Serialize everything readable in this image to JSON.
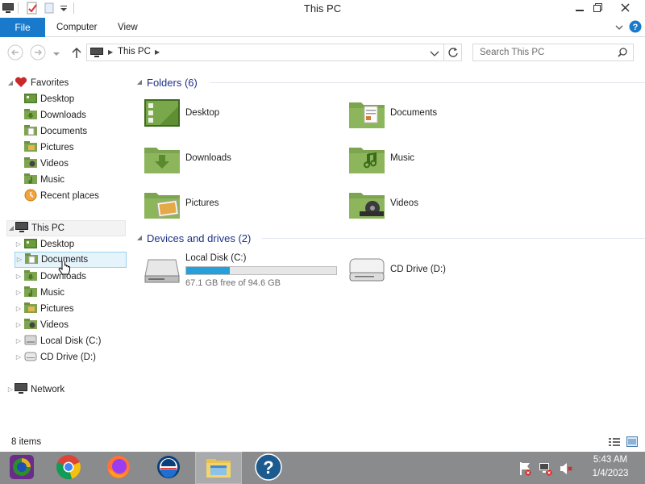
{
  "window": {
    "title": "This PC",
    "controls": {
      "minimize": "minimize-icon",
      "maximize": "maximize-icon",
      "close": "close-icon"
    }
  },
  "ribbon": {
    "file_label": "File",
    "tabs": [
      {
        "label": "Computer"
      },
      {
        "label": "View"
      }
    ]
  },
  "address": {
    "crumbs": [
      "This PC"
    ],
    "search_placeholder": "Search This PC"
  },
  "nav": {
    "favorites": {
      "label": "Favorites",
      "items": [
        {
          "label": "Desktop"
        },
        {
          "label": "Downloads"
        },
        {
          "label": "Documents"
        },
        {
          "label": "Pictures"
        },
        {
          "label": "Videos"
        },
        {
          "label": "Music"
        },
        {
          "label": "Recent places"
        }
      ]
    },
    "thispc": {
      "label": "This PC",
      "items": [
        {
          "label": "Desktop"
        },
        {
          "label": "Documents"
        },
        {
          "label": "Downloads"
        },
        {
          "label": "Music"
        },
        {
          "label": "Pictures"
        },
        {
          "label": "Videos"
        },
        {
          "label": "Local Disk (C:)"
        },
        {
          "label": "CD Drive (D:)"
        }
      ]
    },
    "network": {
      "label": "Network"
    }
  },
  "content": {
    "folders_header": "Folders (6)",
    "folders": [
      {
        "label": "Desktop"
      },
      {
        "label": "Documents"
      },
      {
        "label": "Downloads"
      },
      {
        "label": "Music"
      },
      {
        "label": "Pictures"
      },
      {
        "label": "Videos"
      }
    ],
    "devices_header": "Devices and drives (2)",
    "drives": [
      {
        "label": "Local Disk (C:)",
        "free": "67.1 GB free of 94.6 GB",
        "used_fraction": 0.29
      },
      {
        "label": "CD Drive (D:)"
      }
    ]
  },
  "status": {
    "items": "8 items"
  },
  "taskbar": {
    "time": "5:43 AM",
    "date": "1/4/2023"
  },
  "colors": {
    "accent": "#1979ca",
    "folder": "#7da54f",
    "header": "#1e3287",
    "usage_bar": "#26a0da"
  }
}
